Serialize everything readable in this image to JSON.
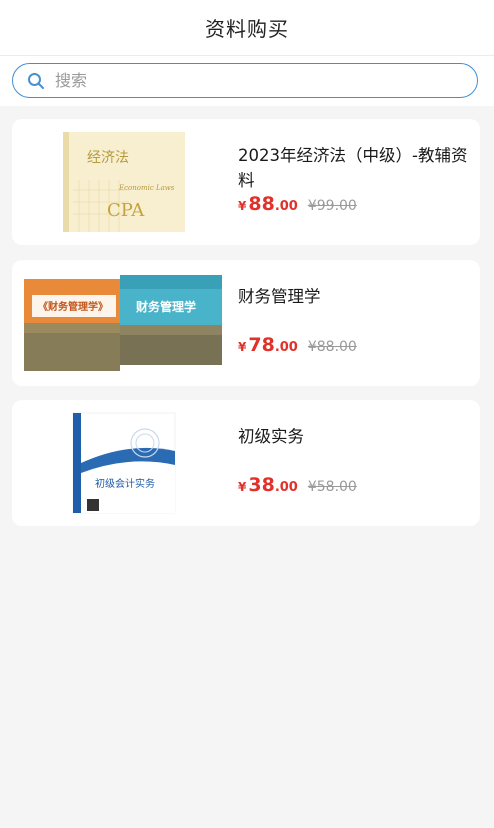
{
  "header": {
    "title": "资料购买"
  },
  "search": {
    "placeholder": "搜索"
  },
  "products": [
    {
      "title": "2023年经济法（中级）-教辅资料",
      "currency": "¥",
      "price_int": "88",
      "price_dec": ".00",
      "old_price": "¥99.00",
      "cover": {
        "title": "经济法",
        "subtitle": "Economic Laws",
        "brand": "CPA"
      }
    },
    {
      "title": "财务管理学",
      "currency": "¥",
      "price_int": "78",
      "price_dec": ".00",
      "old_price": "¥88.00",
      "cover": {
        "title": "财务管理学"
      }
    },
    {
      "title": "初级实务",
      "currency": "¥",
      "price_int": "38",
      "price_dec": ".00",
      "old_price": "¥58.00",
      "cover": {
        "title": "初级会计实务"
      }
    }
  ],
  "colors": {
    "accent": "#3f8fd6",
    "price": "#e0322b",
    "background": "#f5f5f5"
  }
}
